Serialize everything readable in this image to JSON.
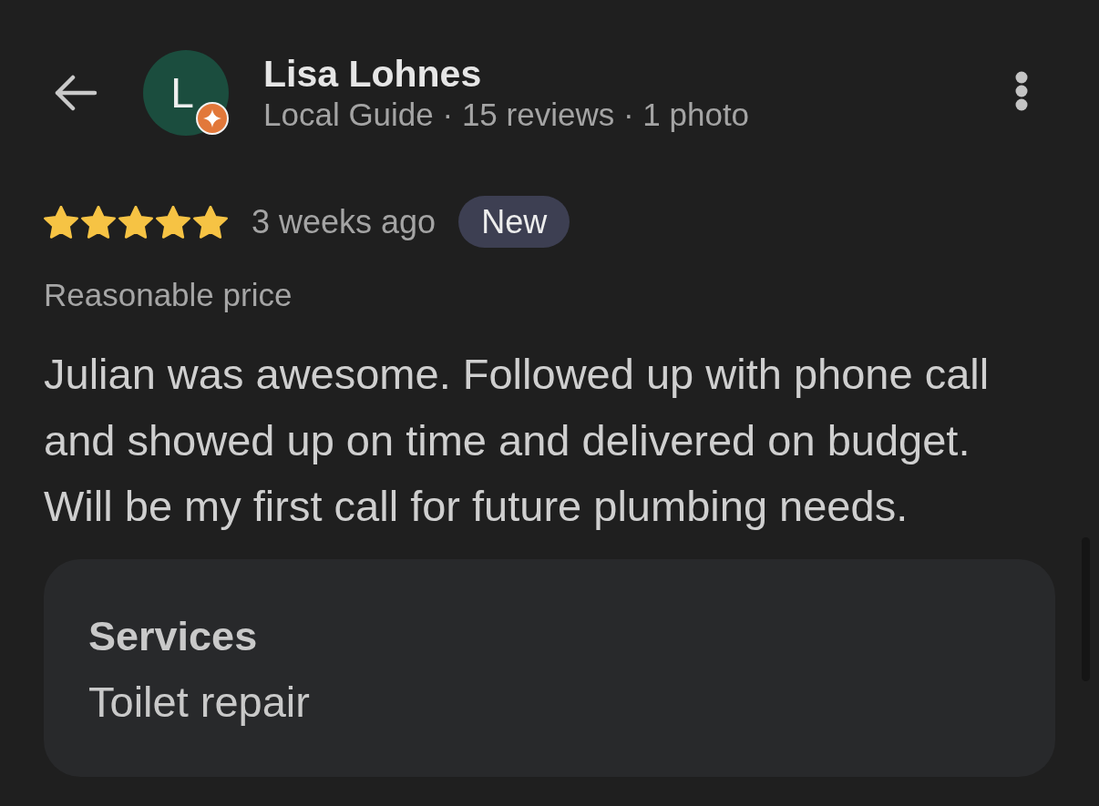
{
  "reviewer": {
    "avatar_letter": "L",
    "name": "Lisa Lohnes",
    "details": "Local Guide · 15 reviews · 1 photo"
  },
  "review": {
    "stars": 5,
    "time": "3 weeks ago",
    "badge": "New",
    "tag": "Reasonable price",
    "text": "Julian was awesome. Followed up with phone call and showed up on time and delivered on budget. Will be my first call for future plumbing needs."
  },
  "services": {
    "title": "Services",
    "items": [
      "Toilet repair"
    ]
  }
}
